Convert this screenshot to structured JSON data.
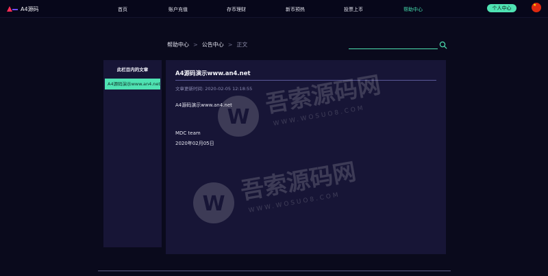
{
  "header": {
    "logo_text": "A4源码",
    "nav": [
      {
        "label": "首页",
        "active": false
      },
      {
        "label": "账户充值",
        "active": false
      },
      {
        "label": "存币理财",
        "active": false
      },
      {
        "label": "新币预热",
        "active": false
      },
      {
        "label": "投票上币",
        "active": false
      },
      {
        "label": "帮助中心",
        "active": true
      }
    ],
    "user_center_label": "个人中心",
    "flag_icon": "china-flag-icon"
  },
  "breadcrumb": {
    "items": [
      "帮助中心",
      "公告中心",
      "正文"
    ],
    "separator": ">"
  },
  "search": {
    "value": "",
    "placeholder": "",
    "icon": "search-icon"
  },
  "sidebar": {
    "title": "此栏目内的文章",
    "items": [
      {
        "label": "A4源码演示www.an4.net",
        "active": true
      }
    ]
  },
  "article": {
    "title": "A4源码演示www.an4.net",
    "time_label": "文章更新时间: 2020-02-05 12:18:55",
    "paragraphs": [
      "A4源码演示www.an4.net",
      "MDC team",
      "2020年02月05日"
    ]
  },
  "watermark": {
    "text": "吾索源码网",
    "sub_text": "WWW.WOSUO8.COM",
    "icon": "w-logo-icon"
  },
  "colors": {
    "accent": "#4fe3b3",
    "background": "#0a0a1c",
    "panel": "#171536"
  }
}
